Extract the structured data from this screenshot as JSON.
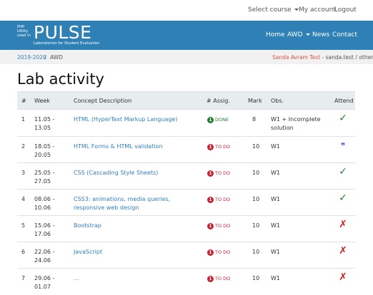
{
  "topbar": {
    "select_course": "Select course",
    "my_account": "My account",
    "logout": "Logout"
  },
  "brand": {
    "line1": "PHP",
    "line2": "Utility",
    "line3": "used in",
    "big": "PULSE",
    "sub": "Laboratories for Student Evaluation"
  },
  "nav": {
    "home": "Home",
    "awd": "AWD",
    "news": "News",
    "contact": "Contact"
  },
  "breadcrumb": {
    "year": "2019-2020",
    "sep": "/",
    "course": "AWD",
    "user_name": "Sanda Avram Test",
    "user_rest": " - sanda.test / others"
  },
  "page": {
    "title": "Lab activity"
  },
  "table": {
    "headers": {
      "num": "#",
      "week": "Week",
      "concept": "Concept Description",
      "assig": "# Assig.",
      "mark": "Mark",
      "obs": "Obs.",
      "attend": "Attend"
    },
    "rows": [
      {
        "num": "1",
        "week": "11.05 - 13.05",
        "concept": "HTML (HyperText Markup Language)",
        "badge": "1",
        "status": "DONE",
        "status_type": "done",
        "mark": "8",
        "obs": "W1 + Incomplete solution",
        "attend": "✓",
        "attend_type": "present"
      },
      {
        "num": "2",
        "week": "18.05 - 20.05",
        "concept": "HTML Forms & HTML validation",
        "badge": "1",
        "status": "TO DO",
        "status_type": "todo",
        "mark": "10",
        "obs": "W1",
        "attend": "❞",
        "attend_type": "motivated"
      },
      {
        "num": "3",
        "week": "25.05 - 27.05",
        "concept": "CSS (Cascading Style Sheets)",
        "badge": "1",
        "status": "TO DO",
        "status_type": "todo",
        "mark": "10",
        "obs": "W1",
        "attend": "✓",
        "attend_type": "present"
      },
      {
        "num": "4",
        "week": "08.06 - 10.06",
        "concept": "CSS3: animations, media queries, responsive web design",
        "badge": "1",
        "status": "TO DO",
        "status_type": "todo",
        "mark": "10",
        "obs": "W1",
        "attend": "✓",
        "attend_type": "present"
      },
      {
        "num": "5",
        "week": "15.06 - 17.06",
        "concept": "Bootstrap",
        "badge": "1",
        "status": "TO DO",
        "status_type": "todo",
        "mark": "10",
        "obs": "W1",
        "attend": "✗",
        "attend_type": "absent"
      },
      {
        "num": "6",
        "week": "22.06 - 24.06",
        "concept": "JavaScript",
        "badge": "1",
        "status": "TO DO",
        "status_type": "todo",
        "mark": "10",
        "obs": "W1",
        "attend": "✗",
        "attend_type": "absent"
      },
      {
        "num": "7",
        "week": "29.06 - 01.07",
        "concept": "...",
        "badge": "1",
        "status": "TO DO",
        "status_type": "todo",
        "mark": "10",
        "obs": "W1",
        "attend": "✗",
        "attend_type": "absent"
      }
    ]
  },
  "icons": {
    "present": "check-icon",
    "absent": "cross-icon",
    "motivated": "quote-icon"
  },
  "colors": {
    "navbar": "#2f80b5",
    "link": "#2f7fc1",
    "done": "#1e7d34",
    "todo": "#c82333",
    "user": "#d9534f"
  }
}
